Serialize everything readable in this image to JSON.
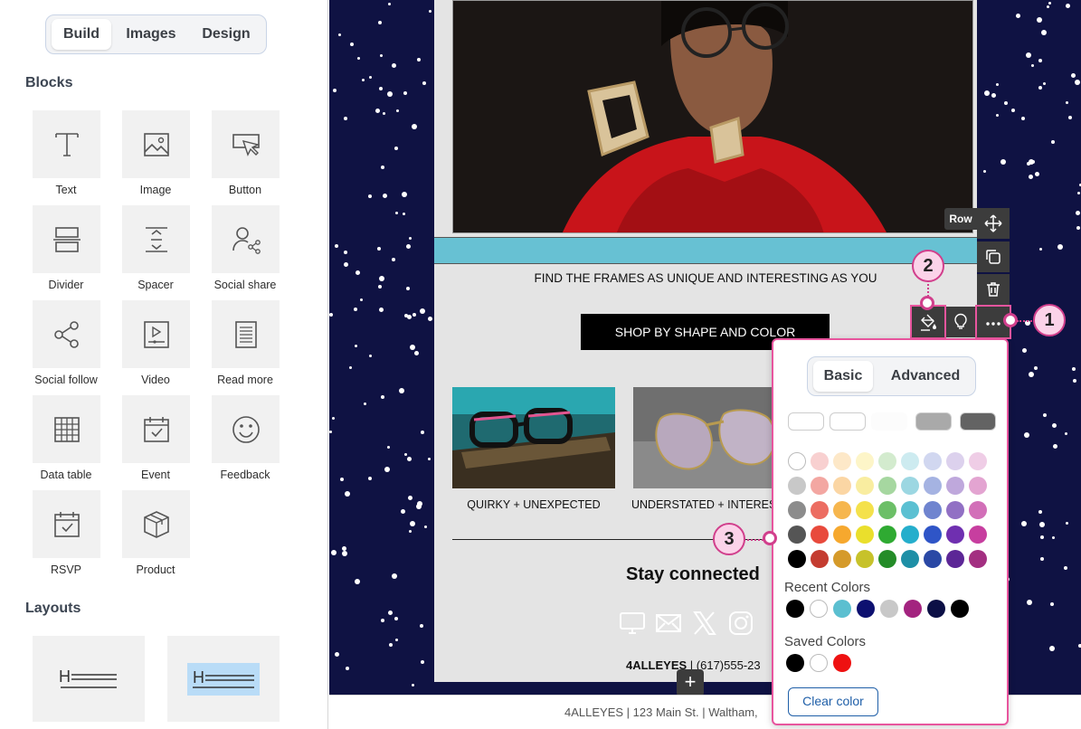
{
  "sidebar": {
    "tabs": [
      {
        "label": "Build",
        "active": true
      },
      {
        "label": "Images",
        "active": false
      },
      {
        "label": "Design",
        "active": false
      }
    ],
    "blocks_title": "Blocks",
    "blocks": [
      {
        "label": "Text",
        "icon": "text-icon"
      },
      {
        "label": "Image",
        "icon": "image-icon"
      },
      {
        "label": "Button",
        "icon": "button-icon"
      },
      {
        "label": "Divider",
        "icon": "divider-icon"
      },
      {
        "label": "Spacer",
        "icon": "spacer-icon"
      },
      {
        "label": "Social share",
        "icon": "social-share-icon"
      },
      {
        "label": "Social follow",
        "icon": "social-follow-icon"
      },
      {
        "label": "Video",
        "icon": "video-icon"
      },
      {
        "label": "Read more",
        "icon": "read-more-icon"
      },
      {
        "label": "Data table",
        "icon": "data-table-icon"
      },
      {
        "label": "Event",
        "icon": "event-icon"
      },
      {
        "label": "Feedback",
        "icon": "feedback-icon"
      },
      {
        "label": "RSVP",
        "icon": "rsvp-icon"
      },
      {
        "label": "Product",
        "icon": "product-icon"
      }
    ],
    "layouts_title": "Layouts",
    "layouts": [
      {
        "glyph": "H"
      },
      {
        "glyph": "H"
      }
    ]
  },
  "email": {
    "tagline": "FIND THE FRAMES AS UNIQUE AND INTERESTING AS YOU",
    "shop_button": "SHOP BY SHAPE AND COLOR",
    "products": [
      {
        "caption": "QUIRKY + UNEXPECTED"
      },
      {
        "caption": "UNDERSTATED + INTERES"
      }
    ],
    "stay_connected": "Stay connected",
    "company_name": "4ALLEYES",
    "company_phone": " | (617)555-23",
    "footer_address": "4ALLEYES | 123 Main St. | Waltham,",
    "add_button": "+"
  },
  "row_toolbar": {
    "label": "Row",
    "tools": [
      "move-icon",
      "duplicate-icon",
      "delete-icon",
      "more-options-icon",
      "lightbulb-icon",
      "paint-bucket-icon"
    ]
  },
  "callouts": [
    "1",
    "2",
    "3"
  ],
  "color_picker": {
    "tabs": [
      {
        "label": "Basic",
        "active": true
      },
      {
        "label": "Advanced",
        "active": false
      }
    ],
    "top_pills": [
      "#ffffff",
      "#ffffff",
      "#fcfcfc",
      "#a9a9a9",
      "#636363"
    ],
    "grid": [
      [
        "#ffffff",
        "#f8d0d0",
        "#fde8c8",
        "#fdf5c8",
        "#d3ebce",
        "#cdebf0",
        "#d1d7f0",
        "#dcd1ed",
        "#efcde6"
      ],
      [
        "#c8c8c8",
        "#f3a7a2",
        "#fbd6a4",
        "#f9eda0",
        "#a6d7a0",
        "#9cd7e2",
        "#a5b3e2",
        "#bfa8dc",
        "#e3a4d1"
      ],
      [
        "#8c8c8c",
        "#ec6d62",
        "#f6b64e",
        "#f4e14b",
        "#6cbf67",
        "#5bc0d2",
        "#6f84cf",
        "#9170c4",
        "#d26fb8"
      ],
      [
        "#555555",
        "#e84a3c",
        "#f6a82e",
        "#eadf2c",
        "#2faa32",
        "#25aecc",
        "#2f55c7",
        "#6f2fb0",
        "#c73e9f"
      ],
      [
        "#000000",
        "#c43c30",
        "#d59a2a",
        "#c7c22a",
        "#248c28",
        "#1e8fa6",
        "#2a48a5",
        "#5c2696",
        "#a32f81"
      ]
    ],
    "recent_label": "Recent Colors",
    "recent": [
      "#000000",
      "#ffffff",
      "#5bbfd0",
      "#0d1070",
      "#c8c8c8",
      "#a3237f",
      "#0b0f45",
      "#000000"
    ],
    "saved_label": "Saved Colors",
    "saved": [
      "#000000",
      "#ffffff",
      "#ee1111"
    ],
    "clear_label": "Clear color"
  }
}
